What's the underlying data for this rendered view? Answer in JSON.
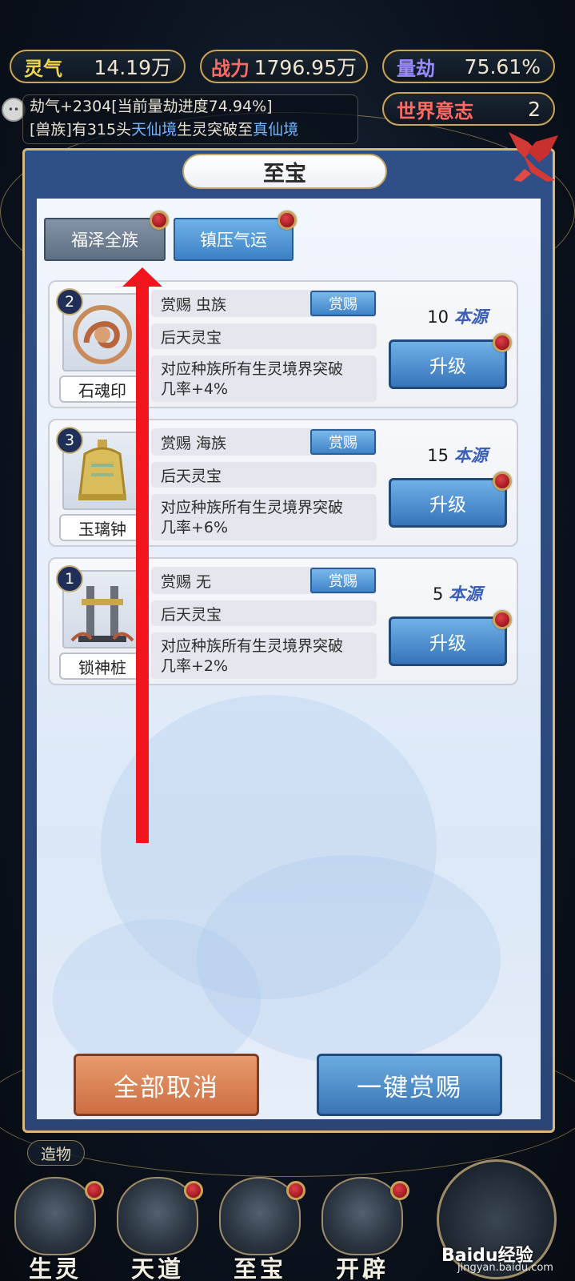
{
  "stats": {
    "lingqi": {
      "label": "灵气",
      "value": "14.19万",
      "color": "#f2d54a"
    },
    "zhanli": {
      "label": "战力",
      "value": "1796.95万",
      "color": "#ff6b63"
    },
    "liangjie": {
      "label": "量劫",
      "value": "75.61%",
      "color": "#9a8cff"
    },
    "world_will": {
      "label": "世界意志",
      "value": "2",
      "color": "#ff6b63"
    }
  },
  "ticker": {
    "line1": "劫气+2304[当前量劫进度74.94%]",
    "line2_prefix": "[兽族]有315头",
    "line2_hl1": "天仙境",
    "line2_mid": "生灵突破至",
    "line2_hl2": "真仙境"
  },
  "modal": {
    "title": "至宝",
    "tabs": [
      {
        "label": "福泽全族",
        "selected": true
      },
      {
        "label": "镇压气运",
        "selected": false
      }
    ],
    "reward_btn_label": "赏赐",
    "upgrade_btn_label": "升级",
    "source_unit": "本源",
    "items": [
      {
        "number": "2",
        "name": "石魂印",
        "reward": "赏赐  虫族",
        "grade": "后天灵宝",
        "effect_line1": "对应种族所有生灵境界突破",
        "effect_line2": "几率+4%",
        "cost": "10"
      },
      {
        "number": "3",
        "name": "玉璃钟",
        "reward": "赏赐  海族",
        "grade": "后天灵宝",
        "effect_line1": "对应种族所有生灵境界突破",
        "effect_line2": "几率+6%",
        "cost": "15"
      },
      {
        "number": "1",
        "name": "锁神桩",
        "reward": "赏赐  无",
        "grade": "后天灵宝",
        "effect_line1": "对应种族所有生灵境界突破",
        "effect_line2": "几率+2%",
        "cost": "5"
      }
    ],
    "cancel_all": "全部取消",
    "one_key_reward": "一键赏赐"
  },
  "zaowu": "造物",
  "bottom_nav": [
    "生灵",
    "天道",
    "至宝",
    "开辟"
  ],
  "watermark": {
    "main": "Baidu经验",
    "sub": "jingyan.baidu.com"
  },
  "colors": {
    "annotation_arrow": "#f2151e",
    "notification_dot": "#c8202a"
  }
}
